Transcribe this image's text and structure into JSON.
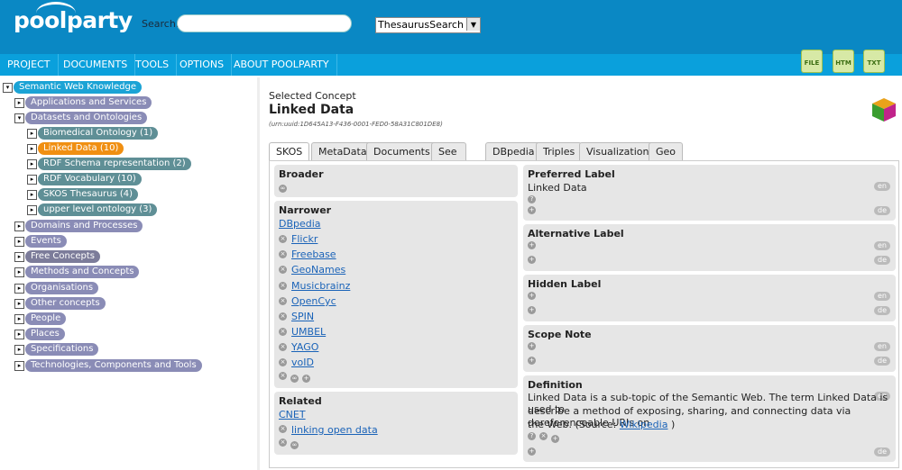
{
  "header": {
    "logo": "poolparty",
    "search_label": "Search:",
    "search_value": "",
    "search_type": "ThesaurusSearch"
  },
  "nav": [
    "PROJECT",
    "DOCUMENTS",
    "TOOLS",
    "OPTIONS",
    "ABOUT POOLPARTY"
  ],
  "exports": [
    "FILE",
    "HTM",
    "TXT"
  ],
  "tree": [
    {
      "label": "Semantic Web Knowledge",
      "toggle": "▾"
    },
    {
      "label": "Applications and Services",
      "toggle": "▸"
    },
    {
      "label": "Datasets and Ontologies",
      "toggle": "▾"
    },
    {
      "label": "Biomedical Ontology (1)",
      "toggle": "▸"
    },
    {
      "label": "Linked Data (10)",
      "toggle": "▸"
    },
    {
      "label": "RDF Schema representation (2)",
      "toggle": "▸"
    },
    {
      "label": "RDF Vocabulary (10)",
      "toggle": "▸"
    },
    {
      "label": "SKOS Thesaurus (4)",
      "toggle": "▸"
    },
    {
      "label": "upper level ontology (3)",
      "toggle": "▸"
    },
    {
      "label": "Domains and Processes",
      "toggle": "▸"
    },
    {
      "label": "Events",
      "toggle": "▸"
    },
    {
      "label": "Free Concepts",
      "toggle": "▸"
    },
    {
      "label": "Methods and Concepts",
      "toggle": "▸"
    },
    {
      "label": "Organisations",
      "toggle": "▸"
    },
    {
      "label": "Other concepts",
      "toggle": "▸"
    },
    {
      "label": "People",
      "toggle": "▸"
    },
    {
      "label": "Places",
      "toggle": "▸"
    },
    {
      "label": "Specifications",
      "toggle": "▸"
    },
    {
      "label": "Technologies, Components and Tools",
      "toggle": "▸"
    }
  ],
  "concept": {
    "label": "Selected Concept",
    "title": "Linked Data",
    "uri": "(urn:uuid:1D645A13-F436-0001-FED0-58A31C801DE8)"
  },
  "tabs": [
    "SKOS",
    "MetaData",
    "Documents",
    "See Also",
    "DBpedia",
    "Triples",
    "Visualization",
    "Geo"
  ],
  "skos": {
    "broader_title": "Broader",
    "narrower_title": "Narrower",
    "narrower_first": "DBpedia",
    "narrower": [
      "Flickr",
      "Freebase",
      "GeoNames",
      "Musicbrainz",
      "OpenCyc",
      "SPIN",
      "UMBEL",
      "YAGO",
      "voID"
    ],
    "related_title": "Related",
    "related_first": "CNET",
    "related": [
      "linking open data"
    ],
    "pref_title": "Preferred Label",
    "pref_value": "Linked Data",
    "alt_title": "Alternative Label",
    "hidden_title": "Hidden Label",
    "scope_title": "Scope Note",
    "def_title": "Definition",
    "def_line1": "Linked Data is a sub-topic of the Semantic Web. The term Linked Data is used to",
    "def_line2": "describe a method of exposing, sharing, and connecting data via dereferenceable URIs on",
    "def_line3a": "the Web. (Source: ",
    "def_link": "Wikipedia",
    "def_line3b": " )",
    "lang_en": "en",
    "lang_de": "de"
  }
}
